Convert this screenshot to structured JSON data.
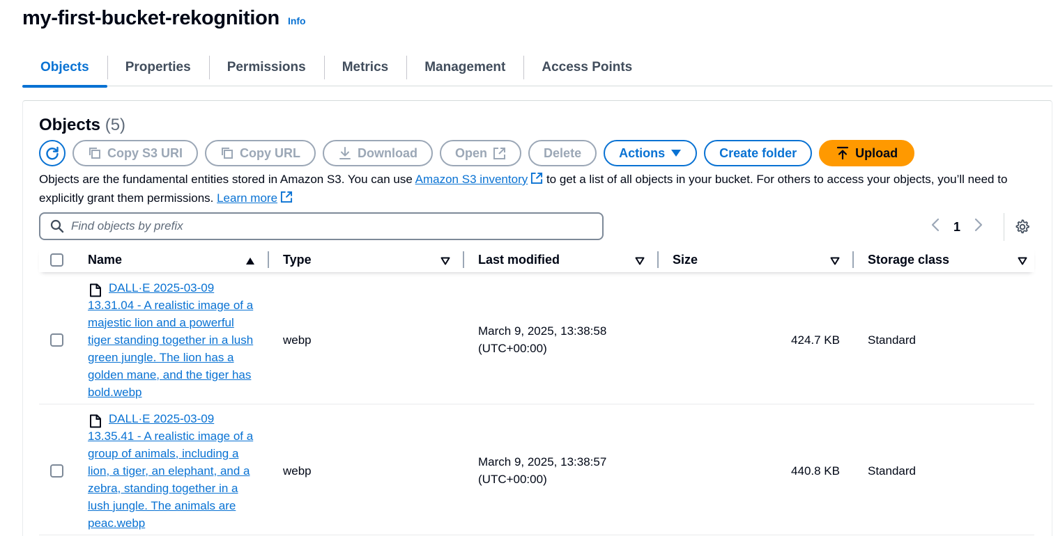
{
  "header": {
    "bucket_name": "my-first-bucket-rekognition",
    "info_label": "Info"
  },
  "tabs": [
    {
      "label": "Objects",
      "active": true
    },
    {
      "label": "Properties",
      "active": false
    },
    {
      "label": "Permissions",
      "active": false
    },
    {
      "label": "Metrics",
      "active": false
    },
    {
      "label": "Management",
      "active": false
    },
    {
      "label": "Access Points",
      "active": false
    }
  ],
  "objects_panel": {
    "title": "Objects",
    "count": "(5)",
    "toolbar": {
      "copy_s3_uri": "Copy S3 URI",
      "copy_url": "Copy URL",
      "download": "Download",
      "open": "Open",
      "delete": "Delete",
      "actions": "Actions",
      "create_folder": "Create folder",
      "upload": "Upload"
    },
    "description": {
      "part1": "Objects are the fundamental entities stored in Amazon S3. You can use ",
      "inventory_link": "Amazon S3 inventory",
      "part2": " to get a list of all objects in your bucket. For others to access your objects, you’ll need to explicitly grant them permissions. ",
      "learn_more": "Learn more"
    },
    "search": {
      "placeholder": "Find objects by prefix",
      "value": ""
    },
    "pagination": {
      "current_page": "1",
      "prev_icon": "chevron-left-icon",
      "next_icon": "chevron-right-icon"
    },
    "columns": {
      "name": "Name",
      "type": "Type",
      "last_modified": "Last modified",
      "size": "Size",
      "storage_class": "Storage class"
    },
    "rows": [
      {
        "name": "DALL·E 2025-03-09 13.31.04 - A realistic image of a majestic lion and a powerful tiger standing together in a lush green jungle. The lion has a golden mane, and the tiger has bold.webp",
        "type": "webp",
        "last_modified": "March 9, 2025, 13:38:58 (UTC+00:00)",
        "size": "424.7 KB",
        "storage_class": "Standard"
      },
      {
        "name": "DALL·E 2025-03-09 13.35.41 - A realistic image of a group of animals, including a lion, a tiger, an elephant, and a zebra, standing together in a lush jungle. The animals are peac.webp",
        "type": "webp",
        "last_modified": "March 9, 2025, 13:38:57 (UTC+00:00)",
        "size": "440.8 KB",
        "storage_class": "Standard"
      }
    ]
  },
  "colors": {
    "accent": "#0972d3",
    "upload_bg": "#ff9900",
    "disabled": "#9ba7b6",
    "text": "#000716"
  }
}
